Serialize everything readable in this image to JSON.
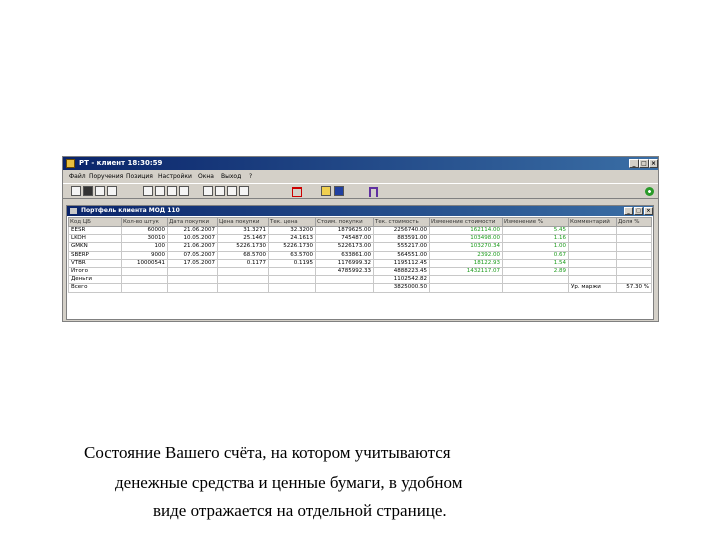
{
  "app": {
    "title": "PT - клиент  18:30:59",
    "buttons": {
      "minimize": "_",
      "maximize": "□",
      "close": "×"
    }
  },
  "menu": [
    "Файл",
    "Поручения",
    "Позиция",
    "Настройки",
    "Окна",
    "Выход",
    "?"
  ],
  "toolbar_icons": [
    "new-order-icon",
    "cancel-order-icon",
    "orders-list-icon",
    "trades-icon",
    "portfolio-icon",
    "quotes-icon",
    "chart-icon",
    "print-icon",
    "import-icon",
    "export-icon",
    "refresh-icon",
    "settings-icon",
    "red-report-icon",
    "folder-icon",
    "save-icon",
    "lock-icon",
    "connection-icon"
  ],
  "portfolio": {
    "title": "Портфель клиента МОД 110",
    "columns": [
      "Код ЦБ",
      "Кол-во штук",
      "Дата покупки",
      "Цена покупки",
      "Тек. цена",
      "Стоим. покупки",
      "Тек. стоимость",
      "Изменение стоимости",
      "Изменение %",
      "Комментарий",
      "Доля %"
    ],
    "rows": [
      [
        "EESR",
        "60000",
        "21.06.2007",
        "31.3271",
        "32.3200",
        "1879625.00",
        "2256740.00",
        "162114.00",
        "5.45",
        "",
        ""
      ],
      [
        "LKOH",
        "30010",
        "10.05.2007",
        "25.1467",
        "24.1613",
        "745487.00",
        "883591.00",
        "103498.00",
        "1.16",
        "",
        ""
      ],
      [
        "GMKN",
        "100",
        "21.06.2007",
        "5226.1730",
        "5226.1730",
        "5226173.00",
        "555217.00",
        "103270.34",
        "1.00",
        "",
        ""
      ],
      [
        "SBERP",
        "9000",
        "07.05.2007",
        "68.5700",
        "63.5700",
        "633861.00",
        "564551.00",
        "2392.00",
        "0.67",
        "",
        ""
      ],
      [
        "VTBR",
        "10000541",
        "17.05.2007",
        "0.1177",
        "0.1195",
        "1176999.32",
        "1195112.45",
        "18122.93",
        "1.54",
        "",
        ""
      ],
      [
        "Итого",
        "",
        "",
        "",
        "",
        "4785992.33",
        "4888223.45",
        "1432117.07",
        "2.89",
        "",
        ""
      ],
      [
        "Деньги",
        "",
        "",
        "",
        "",
        "",
        "1102542.82",
        "",
        "",
        "",
        ""
      ],
      [
        "Всего",
        "",
        "",
        "",
        "",
        "",
        "3825000.50",
        "",
        "",
        "Ур. маржи",
        "57.30 %"
      ]
    ]
  },
  "caption": {
    "line1": "Состояние Вашего счёта, на котором учитываются",
    "line2": "денежные средства и ценные бумаги, в удобном",
    "line3": "виде отражается на отдельной странице."
  }
}
